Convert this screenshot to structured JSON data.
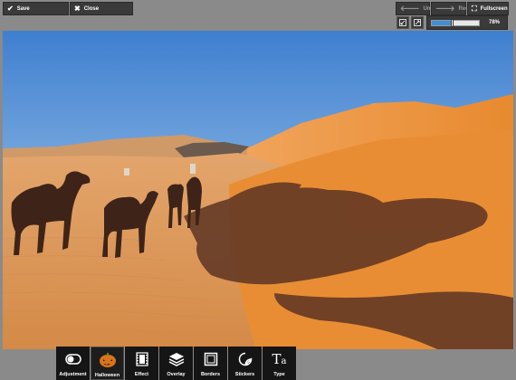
{
  "topbar": {
    "save_label": "Save",
    "close_label": "Close",
    "undo_label": "Undo",
    "redo_label": "Redo",
    "fullscreen_label": "Fullscreen"
  },
  "zoom": {
    "level": "78%",
    "fraction": 0.42
  },
  "image": {
    "subject": "camel caravan in desert dunes"
  },
  "tools": [
    {
      "label": "Adjustment",
      "icon": "toggle-icon"
    },
    {
      "label": "Halloween",
      "icon": "pumpkin-icon"
    },
    {
      "label": "Effect",
      "icon": "film-icon"
    },
    {
      "label": "Overlay",
      "icon": "layers-icon"
    },
    {
      "label": "Borders",
      "icon": "frame-icon"
    },
    {
      "label": "Stickers",
      "icon": "sticker-icon"
    },
    {
      "label": "Type",
      "icon": "text-icon"
    }
  ],
  "colors": {
    "toolbar_bg": "#151515",
    "zoom_fill": "#3d8fd6"
  }
}
